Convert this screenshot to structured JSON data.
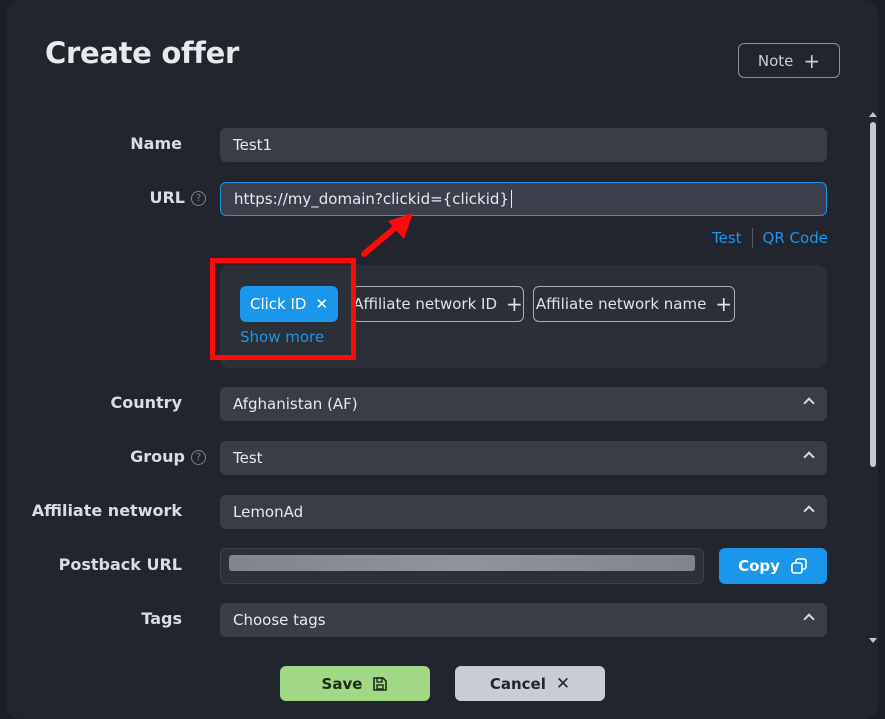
{
  "dialog": {
    "title": "Create offer",
    "note_button": "Note",
    "note_icon": "+"
  },
  "form": {
    "name": {
      "label": "Name",
      "value": "Test1"
    },
    "url": {
      "label": "URL",
      "value": "https://my_domain?clickid={clickid}",
      "help": "?"
    },
    "url_links": {
      "test": "Test",
      "qr_code": "QR Code"
    },
    "tokens": [
      {
        "label": "Click ID",
        "icon": "✕",
        "active": true
      },
      {
        "label": "Affiliate network ID",
        "icon": "+",
        "active": false
      },
      {
        "label": "Affiliate network name",
        "icon": "+",
        "active": false
      }
    ],
    "show_more": "Show more",
    "country": {
      "label": "Country",
      "value": "Afghanistan (AF)"
    },
    "group": {
      "label": "Group",
      "value": "Test",
      "help": "?"
    },
    "affiliate_network": {
      "label": "Affiliate network",
      "value": "LemonAd"
    },
    "postback": {
      "label": "Postback URL",
      "copy_label": "Copy"
    },
    "tags": {
      "label": "Tags",
      "placeholder": "Choose tags"
    }
  },
  "footer": {
    "save_label": "Save",
    "cancel_label": "Cancel",
    "cancel_icon": "✕"
  },
  "colors": {
    "accent": "#1a96ea",
    "save": "#a1d886",
    "annotation": "#ff0a0a"
  }
}
